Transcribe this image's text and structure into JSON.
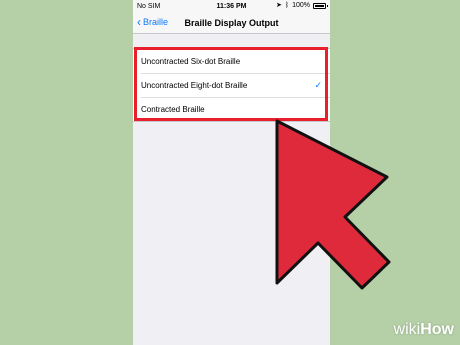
{
  "status_bar": {
    "carrier": "No SIM",
    "time": "11:36 PM",
    "battery": "100%"
  },
  "nav": {
    "back_label": "Braille",
    "title": "Braille Display Output"
  },
  "options": [
    {
      "label": "Uncontracted Six-dot Braille",
      "selected": false
    },
    {
      "label": "Uncontracted Eight-dot Braille",
      "selected": true
    },
    {
      "label": "Contracted Braille",
      "selected": false
    }
  ],
  "colors": {
    "accent": "#0a7aff",
    "highlight": "#e8202e",
    "background": "#b5d0a6"
  },
  "watermark": {
    "wiki": "wiki",
    "how": "How"
  }
}
